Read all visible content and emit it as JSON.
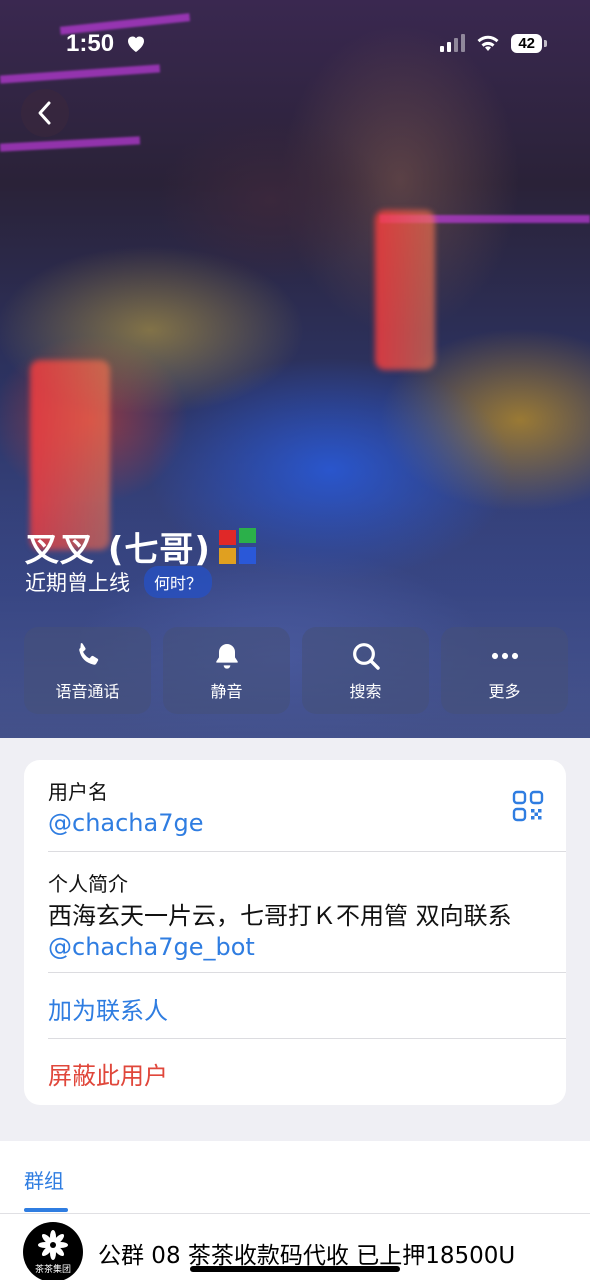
{
  "status_bar": {
    "time": "1:50",
    "battery": "42"
  },
  "profile": {
    "name": "叉叉 (七哥)",
    "last_seen": "近期曾上线",
    "when_label": "何时？"
  },
  "actions": [
    {
      "label": "语音通话",
      "icon": "phone-icon"
    },
    {
      "label": "静音",
      "icon": "bell-icon"
    },
    {
      "label": "搜索",
      "icon": "search-icon"
    },
    {
      "label": "更多",
      "icon": "more-icon"
    }
  ],
  "info": {
    "username_label": "用户名",
    "username": "@chacha7ge",
    "bio_label": "个人简介",
    "bio_text": "西海玄天一片云，七哥打Ｋ不用管 双向联系 ",
    "bio_mention": "@chacha7ge_bot",
    "add_contact": "加为联系人",
    "block_user": "屏蔽此用户"
  },
  "groups": {
    "tab_label": "群组",
    "item": {
      "name": "公群 08 茶茶收款码代收 已上押18500U",
      "avatar_text": "茶茶集团"
    }
  },
  "colors": {
    "accent": "#2f7de1",
    "danger": "#e0473b"
  }
}
